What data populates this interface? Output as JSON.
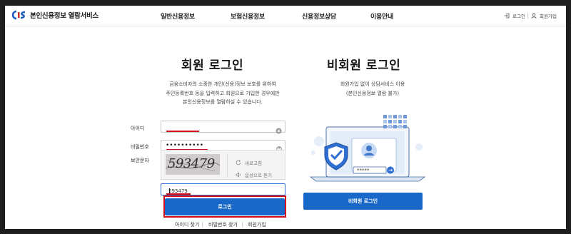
{
  "header": {
    "logo_text": "본인신용정보 열람서비스",
    "nav": [
      "일반신용정보",
      "보험신용정보",
      "신용정보상담",
      "이용안내"
    ],
    "login_link": "로그인",
    "signup_link": "회원가입"
  },
  "member": {
    "title": "회원 로그인",
    "desc": [
      "금융소비자의 소중한 개인(신용)정보 보호를 위하여",
      "주민등록번호 등을 입력하고 회원으로 가입한 경우에만",
      "본인신용정보를 열람하실 수 있습니다."
    ],
    "id_label": "아이디",
    "id_value": "",
    "password_label": "비밀번호",
    "password_value": "••••••••••",
    "captcha_label": "보안문자",
    "captcha_text": "593479",
    "refresh_label": "새로고침",
    "audio_label": "음성으로 듣기",
    "captcha_input_value": "593479",
    "login_button": "로그인",
    "links": [
      "아이디 찾기",
      "비밀번호 찾기",
      "회원가입"
    ]
  },
  "guest": {
    "title": "비회원 로그인",
    "desc": [
      "회원가입 없이 상담서비스 이용",
      "(본인신용정보 열람 불가)"
    ],
    "password_mask": "*****",
    "login_button": "비회원 로그인"
  },
  "colors": {
    "primary": "#1867c9",
    "highlight": "#d10d1a"
  }
}
